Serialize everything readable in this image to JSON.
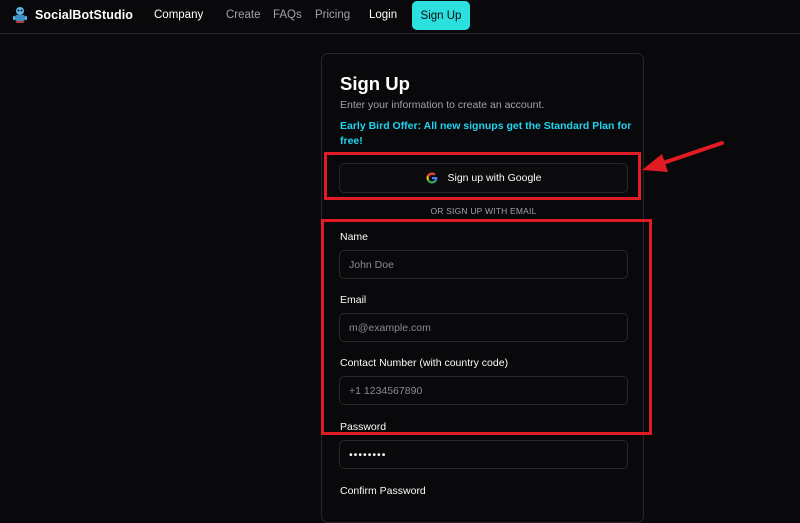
{
  "header": {
    "brand": "SocialBotStudio",
    "nav": {
      "company": "Company",
      "create": "Create",
      "faqs": "FAQs",
      "pricing": "Pricing",
      "login": "Login",
      "signup": "Sign Up"
    }
  },
  "card": {
    "title": "Sign Up",
    "description": "Enter your information to create an account.",
    "offer": "Early Bird Offer: All new signups get the Standard Plan for free!",
    "google_button": "Sign up with Google",
    "divider": "OR SIGN UP WITH EMAIL",
    "fields": {
      "name": {
        "label": "Name",
        "placeholder": "John Doe",
        "value": ""
      },
      "email": {
        "label": "Email",
        "placeholder": "m@example.com",
        "value": ""
      },
      "contact": {
        "label": "Contact Number (with country code)",
        "placeholder": "+1 1234567890",
        "value": ""
      },
      "password": {
        "label": "Password",
        "value": "secret12"
      },
      "confirm_password": {
        "label": "Confirm Password"
      }
    }
  },
  "icons": {
    "brand_logo": "robot-logo-icon",
    "google": "google-icon",
    "annotation_arrow": "red-arrow-icon"
  },
  "colors": {
    "background": "#09090b",
    "accent": "#2de0e0",
    "offer_text": "#22d3ee",
    "border": "#27272a",
    "annotation": "#e01b24"
  }
}
